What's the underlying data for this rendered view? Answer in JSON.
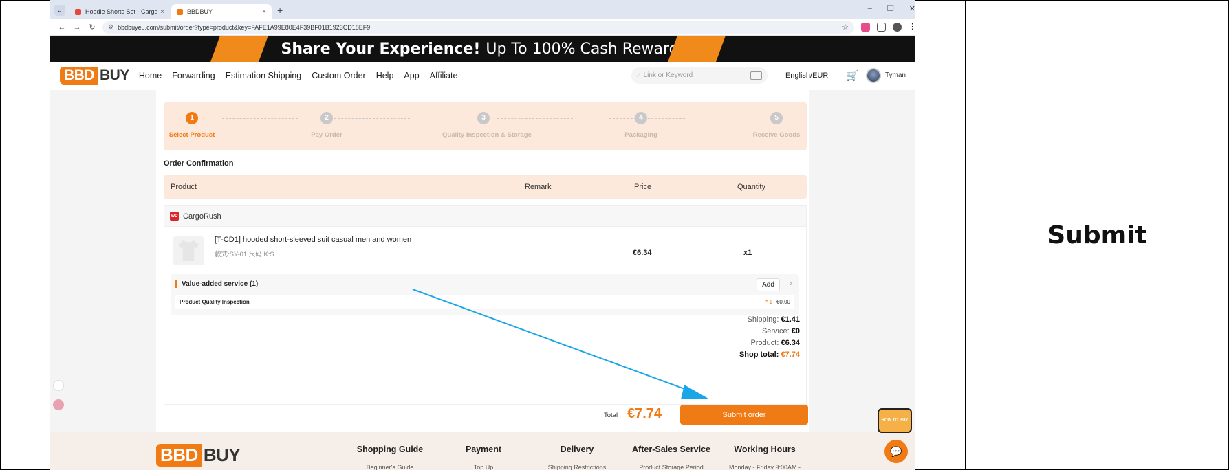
{
  "side_panel": {
    "title": "Submit"
  },
  "browser": {
    "tabs": [
      {
        "label": "Hoodie Shorts Set - CargoRu",
        "close": "×"
      },
      {
        "label": "BBDBUY",
        "close": "×"
      }
    ],
    "new_tab": "+",
    "window_controls": [
      "–",
      "❐",
      "✕"
    ],
    "url": "bbdbuyeu.com/submit/order?type=product&key=FAFE1A99E80E4F39BF01B1923CD18EF9"
  },
  "banner": {
    "bold": "Share Your Experience!",
    "rest": "Up To 100% Cash Reward!"
  },
  "header": {
    "logo_left": "BBD",
    "logo_right": "BUY",
    "nav": [
      "Home",
      "Forwarding",
      "Estimation Shipping",
      "Custom Order",
      "Help",
      "App",
      "Affiliate"
    ],
    "search_placeholder": "Link or Keyword",
    "language": "English/EUR",
    "username": "Tyman"
  },
  "steps": [
    {
      "num": "1",
      "label": "Select Product"
    },
    {
      "num": "2",
      "label": "Pay Order"
    },
    {
      "num": "3",
      "label": "Quality Inspection & Storage"
    },
    {
      "num": "4",
      "label": "Packaging"
    },
    {
      "num": "5",
      "label": "Receive Goods"
    }
  ],
  "order": {
    "title": "Order Confirmation",
    "columns": {
      "product": "Product",
      "remark": "Remark",
      "price": "Price",
      "quantity": "Quantity"
    },
    "shop_name": "CargoRush",
    "shop_badge": "WD",
    "product": {
      "name": "[T-CD1] hooded short-sleeved suit casual men and women",
      "spec": "款式:SY-01;尺码 K:S",
      "price": "€6.34",
      "qty": "x1"
    },
    "vas": {
      "title": "Value-added service (1)",
      "add": "Add",
      "item": "Product Quality Inspection",
      "item_qty": "* 1",
      "item_price": "€0.00"
    },
    "summary": [
      {
        "label": "Shipping:",
        "value": "€1.41"
      },
      {
        "label": "Service:",
        "value": "€0"
      },
      {
        "label": "Product:",
        "value": "€6.34"
      },
      {
        "label": "Shop total:",
        "value": "€7.74"
      }
    ],
    "total_label": "Total",
    "total_amount": "€7.74",
    "submit": "Submit order"
  },
  "footer": {
    "logo_left": "BBD",
    "logo_right": "BUY",
    "columns": [
      {
        "title": "Shopping Guide",
        "sub": "Beginner's Guide"
      },
      {
        "title": "Payment",
        "sub": "Top Up"
      },
      {
        "title": "Delivery",
        "sub": "Shipping Restrictions"
      },
      {
        "title": "After-Sales Service",
        "sub": "Product Storage Period"
      },
      {
        "title": "Working Hours",
        "sub": "Monday - Friday 9:00AM -"
      }
    ]
  },
  "widgets": {
    "how_to_buy": "HOW TO BUY"
  },
  "colors": {
    "accent": "#f07a14",
    "arrow": "#1aa7e8",
    "step_bg": "#fde8dc"
  }
}
